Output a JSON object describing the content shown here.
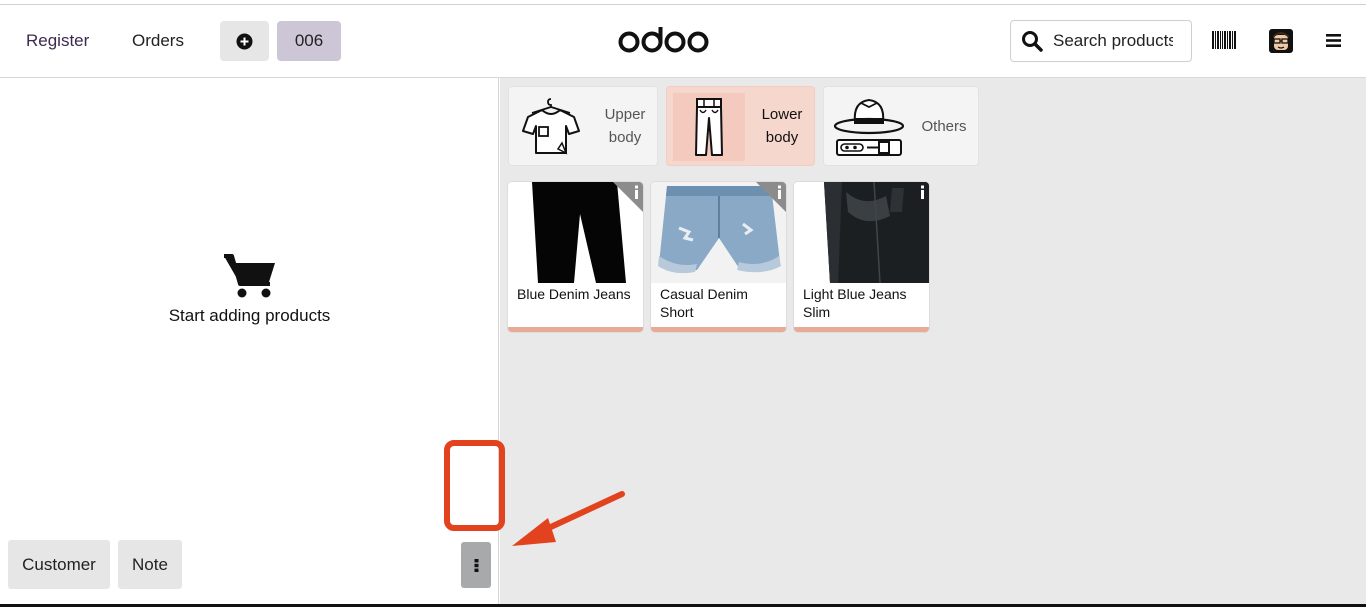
{
  "navbar": {
    "register_label": "Register",
    "orders_label": "Orders",
    "add_order_icon": "plus-circle-icon",
    "current_order": "006",
    "logo_text": "odoo",
    "search_placeholder": "Search products",
    "search_icon": "search-icon",
    "barcode_icon": "barcode-icon",
    "avatar_icon": "user-avatar",
    "menu_icon": "hamburger-menu-icon"
  },
  "order_pane": {
    "empty_icon": "cart-icon",
    "empty_text": "Start adding products",
    "customer_label": "Customer",
    "note_label": "Note",
    "more_icon": "vertical-ellipsis-icon"
  },
  "categories": [
    {
      "label": "Upper body",
      "icon": "tshirt-icon",
      "selected": false
    },
    {
      "label": "Lower body",
      "icon": "trousers-icon",
      "selected": true
    },
    {
      "label": "Others",
      "icon": "hat-belt-icon",
      "selected": false
    }
  ],
  "products": [
    {
      "name": "Blue Denim Jeans"
    },
    {
      "name": "Casual Denim Short"
    },
    {
      "name": "Light Blue Jeans Slim"
    }
  ],
  "colors": {
    "accent_orange": "#e2421d",
    "order_badge": "#cdc6d6",
    "selected_category": "#f6d7cd",
    "product_underline": "#e8ab97"
  }
}
